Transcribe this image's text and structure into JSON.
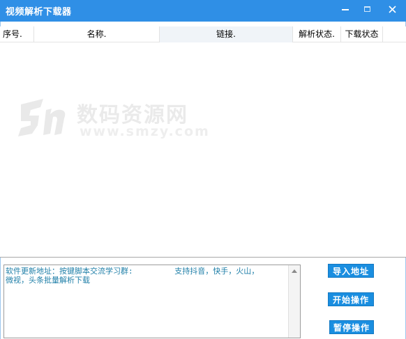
{
  "window": {
    "title": "视频解析下载器",
    "minimize_label": "─",
    "close_label": "✕"
  },
  "list": {
    "columns": [
      "序号.",
      "名称.",
      "链接.",
      "解析状态.",
      "下载状态"
    ],
    "rows": []
  },
  "watermark": {
    "logo_text": "5m",
    "site_name": "数码资源网",
    "url": "www.smzy.com"
  },
  "log": {
    "text": "软件更新地址：按键脚本交流学习群:         支持抖音，快手，火山，\n微视，头条批量解析下载"
  },
  "buttons": {
    "import": "导入地址",
    "start": "开始操作",
    "pause": "暂停操作"
  },
  "colors": {
    "titlebar": "#2f8fe6",
    "button": "#1a8ee0",
    "log_text": "#1f7fa8"
  }
}
